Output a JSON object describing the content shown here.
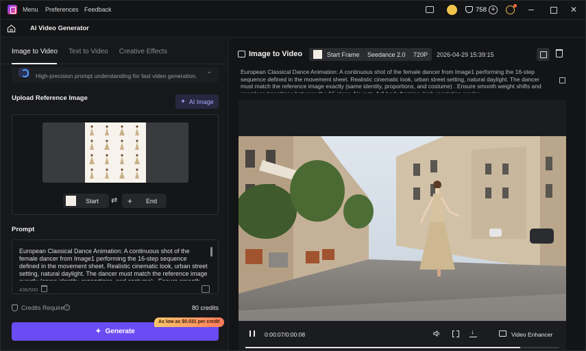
{
  "titlebar": {
    "menu": "Menu",
    "preferences": "Preferences",
    "feedback": "Feedback",
    "credits": "758"
  },
  "header": {
    "title": "AI Video Generator"
  },
  "left": {
    "tabs": [
      "Image to Video",
      "Text to Video",
      "Creative Effects"
    ],
    "model_description": "High-precision prompt understanding for fast video generation.",
    "upload_label": "Upload Reference Image",
    "ai_image_label": "AI Image",
    "start_label": "Start",
    "end_label": "End",
    "prompt_label": "Prompt",
    "prompt_text": "European Classical Dance Animation: A continuous shot of the female dancer from Image1 performing the 16-step sequence defined in the movement sheet. Realistic cinematic look, urban street setting, natural daylight. The dancer must match the reference image exactly (same identity, proportions, and costume) . Ensure smooth weight shifts and seamless transitions between the 16 steps. No cuts, full-body framing, high-resolution render.",
    "char_count": "436/500",
    "credits_label": "Credits Require",
    "credits_value": "80 credits",
    "generate_label": "Generate",
    "promo": "As low as $0.031 per credit"
  },
  "right": {
    "title": "Image to Video",
    "chips": {
      "start_frame": "Start Frame",
      "model": "Seedance 2.0",
      "resolution": "720P"
    },
    "timestamp": "2026-04-29 15:39:15",
    "prompt": "European Classical Dance Animation: A continuous shot of the female dancer from Image1 performing the 16-step sequence defined in the movement sheet. Realistic cinematic look, urban street setting, natural daylight. The dancer must match the reference image exactly (same identity, proportions, and costume) . Ensure smooth weight shifts and seamless transitions between the 16 steps. No cuts, full-body framing, high-resolution render.",
    "player": {
      "time": "0:00:07/0:00:08",
      "enhancer": "Video Enhancer",
      "progress": 0.875
    }
  },
  "colors": {
    "accent": "#6a4cf5",
    "background": "#131416",
    "panel": "#17181b"
  }
}
